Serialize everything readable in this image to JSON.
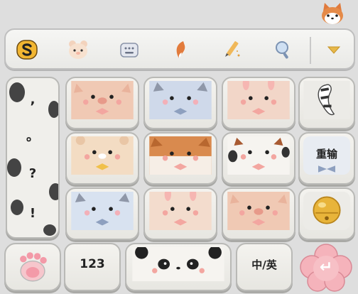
{
  "keyboard": {
    "punctuation": [
      ",",
      "。",
      "?",
      "!"
    ],
    "reenter_label": "重输",
    "numbers_label": "123",
    "lang_label": "中/英",
    "enter_symbol": "↵"
  },
  "toolbar": {
    "icons": [
      "sogou-logo-icon",
      "bear-avatar-icon",
      "keyboard-icon",
      "fox-tail-icon",
      "pencil-icon",
      "search-icon",
      "collapse-arrow-icon"
    ]
  },
  "colors": {
    "background": "#dedede",
    "key_face": "#f4f3ef",
    "key_border": "#b9b9b6",
    "pig_pink": "#f0c9b4",
    "cat_blue": "#cfd9ea",
    "fox_orange": "#d98a4e",
    "bear_beige": "#f3dcc3",
    "enter_pink": "#f5b3bb",
    "bell_gold": "#e8b43a"
  }
}
